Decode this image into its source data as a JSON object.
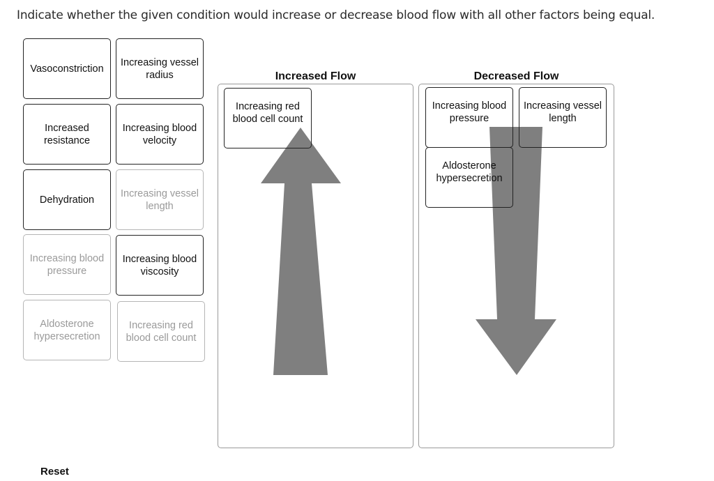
{
  "instruction": "Indicate whether the given condition would increase or decrease blood flow with all other factors being equal.",
  "source_cards": [
    {
      "label": "Vasoconstriction",
      "state": "available"
    },
    {
      "label": "Increasing vessel radius",
      "state": "available"
    },
    {
      "label": "Increased resistance",
      "state": "available"
    },
    {
      "label": "Increasing blood velocity",
      "state": "available"
    },
    {
      "label": "Dehydration",
      "state": "available"
    },
    {
      "label": "Increasing vessel length",
      "state": "used"
    },
    {
      "label": "Increasing blood pressure",
      "state": "used"
    },
    {
      "label": "Increasing blood viscosity",
      "state": "available"
    },
    {
      "label": "Aldosterone hypersecretion",
      "state": "used"
    },
    {
      "label": "Increasing red blood cell count",
      "state": "used"
    }
  ],
  "zones": {
    "increased": {
      "title": "Increased Flow",
      "arrow": "up-arrow",
      "items": [
        {
          "label": "Increasing red blood cell count"
        }
      ]
    },
    "decreased": {
      "title": "Decreased Flow",
      "arrow": "down-arrow",
      "items": [
        {
          "label": "Increasing blood pressure"
        },
        {
          "label": "Increasing vessel length"
        },
        {
          "label": "Aldosterone hypersecretion"
        }
      ]
    }
  },
  "colors": {
    "arrow": "#7f7f7f",
    "card_border": "#222222",
    "used_card_text": "#9a9a9a",
    "zone_border": "#9a9a9a"
  },
  "reset_label": "Reset"
}
